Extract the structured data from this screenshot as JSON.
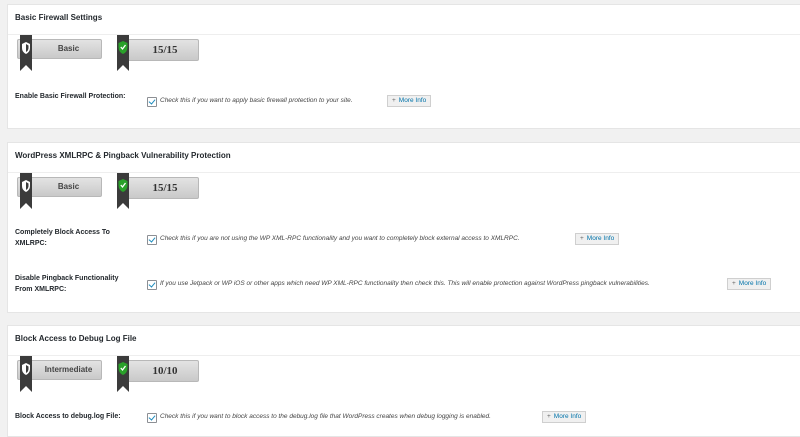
{
  "colors": {
    "accent": "#1e8cbe",
    "shield_green": "#2aa12a",
    "ribbon": "#3b3b3b",
    "link": "#0073aa"
  },
  "sections": [
    {
      "title": "Basic Firewall Settings",
      "level": "Basic",
      "points": "15/15",
      "rows": [
        {
          "label": "Enable Basic Firewall Protection:",
          "checked": true,
          "description": "Check this if you want to apply basic firewall protection to your site.",
          "more_info": "More Info"
        }
      ]
    },
    {
      "title": "WordPress XMLRPC & Pingback Vulnerability Protection",
      "level": "Basic",
      "points": "15/15",
      "rows": [
        {
          "label": "Completely Block Access To XMLRPC:",
          "checked": true,
          "description": "Check this if you are not using the WP XML-RPC functionality and you want to completely block external access to XMLRPC.",
          "more_info": "More Info"
        },
        {
          "label": "Disable Pingback Functionality From XMLRPC:",
          "checked": true,
          "description": "If you use Jetpack or WP iOS or other apps which need WP XML-RPC functionality then check this. This will enable protection against WordPress pingback vulnerabilities.",
          "more_info": "More Info"
        }
      ]
    },
    {
      "title": "Block Access to Debug Log File",
      "level": "Intermediate",
      "points": "10/10",
      "rows": [
        {
          "label": "Block Access to debug.log File:",
          "checked": true,
          "description": "Check this if you want to block access to the debug.log file that WordPress creates when debug logging is enabled.",
          "more_info": "More Info"
        }
      ]
    }
  ]
}
